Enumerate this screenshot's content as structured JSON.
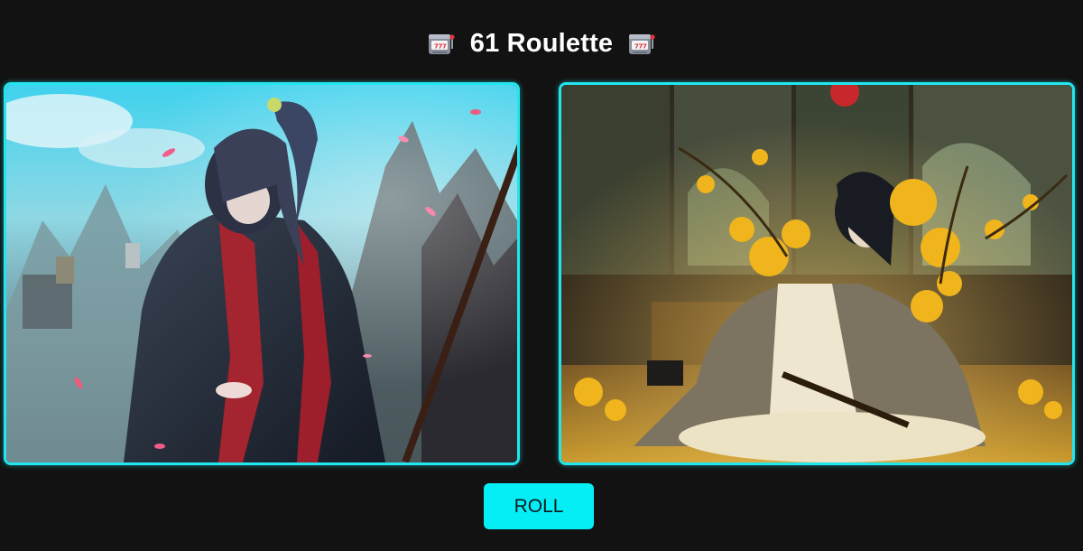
{
  "header": {
    "title": "61 Roulette",
    "left_icon": "slot-machine-icon",
    "right_icon": "slot-machine-icon"
  },
  "cards": [
    {
      "name": "left-artwork",
      "alt": "Anime swordsman with long dark hair and red-black robes holding a spear among mountains and falling petals"
    },
    {
      "name": "right-artwork",
      "alt": "Dark-haired man in white hanbok seated on the floor with golden flowers and painted folding screens behind"
    }
  ],
  "controls": {
    "roll_label": "ROLL"
  },
  "colors": {
    "background": "#121212",
    "accent": "#22e6ee",
    "button": "#05eef6",
    "title": "#ffffff"
  }
}
